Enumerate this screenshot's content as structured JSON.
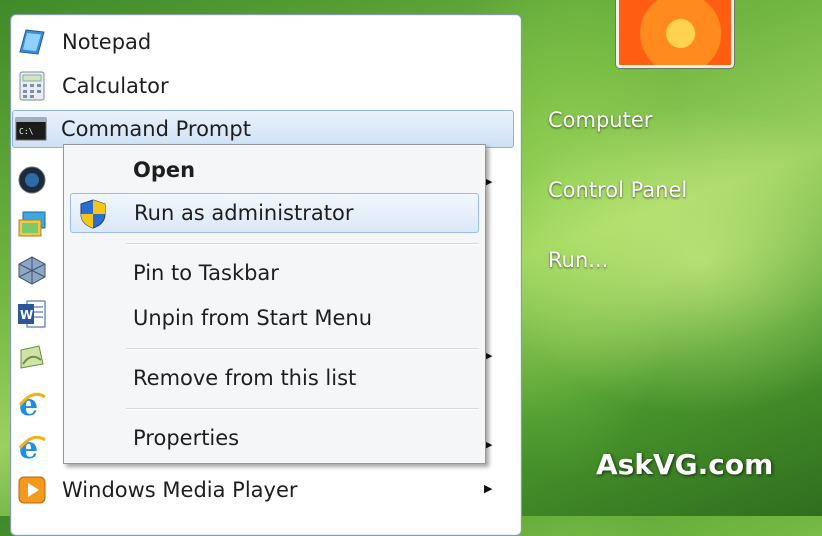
{
  "start_menu": {
    "programs": [
      {
        "label": "Notepad",
        "icon": "notepad-icon"
      },
      {
        "label": "Calculator",
        "icon": "calculator-icon"
      },
      {
        "label": "Command Prompt",
        "icon": "command-prompt-icon",
        "selected": true
      },
      {
        "label": "",
        "icon": "program-icon-dark-globe"
      },
      {
        "label": "",
        "icon": "program-icon-remote-desktop"
      },
      {
        "label": "",
        "icon": "program-icon-virtualbox"
      },
      {
        "label": "",
        "icon": "word-icon"
      },
      {
        "label": "",
        "icon": "program-icon-green-document"
      },
      {
        "label": "",
        "icon": "internet-explorer-icon"
      },
      {
        "label": "",
        "icon": "internet-explorer-icon"
      },
      {
        "label": "Windows Media Player",
        "icon": "windows-media-player-icon"
      }
    ],
    "right_column": [
      "Computer",
      "Control Panel",
      "Run..."
    ]
  },
  "context_menu": {
    "items": [
      {
        "label": "Open",
        "bold": true
      },
      {
        "label": "Run as administrator",
        "highlighted": true,
        "icon": "uac-shield-icon"
      },
      {
        "label": "Pin to Taskbar"
      },
      {
        "label": "Unpin from Start Menu"
      },
      {
        "label": "Remove from this list"
      },
      {
        "label": "Properties"
      }
    ]
  },
  "watermark": "AskVG.com",
  "colors": {
    "accent_highlight": "#cfe1f6",
    "desktop_green": "#6fb53f"
  }
}
